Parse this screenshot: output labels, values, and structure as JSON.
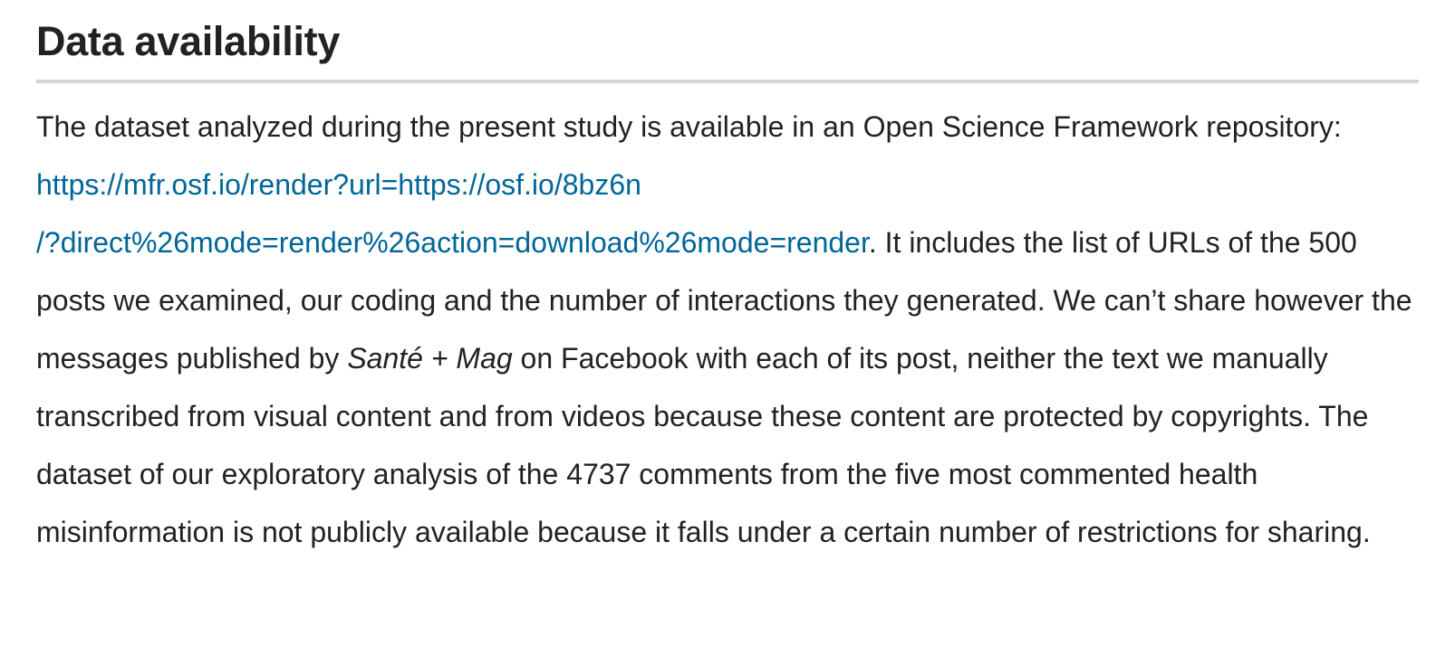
{
  "section": {
    "title": "Data availability",
    "paragraph": {
      "part1": "The dataset analyzed during the present study is available in an Open Science Framework repository: ",
      "link_line1": "https://mfr.osf.io/render?url=https://osf.io/8bz6n",
      "link_line2": "/?direct%26mode=render%26action=download%26mode=render",
      "part2": ". It includes the list of URLs of the 500 posts we examined, our coding and the number of interactions they generated. We can’t share however the messages published by ",
      "italic_name": "Santé + Mag",
      "part3": " on Facebook with each of its post, neither the text we manually transcribed from visual content and from videos because these content are protected by copyrights. The dataset of our exploratory analysis of the 4737 comments from the five most commented health misinformation is not publicly available because it falls under a certain number of restrictions for sharing."
    }
  },
  "colors": {
    "text": "#222222",
    "link": "#006699",
    "rule": "#d5d5d5"
  }
}
